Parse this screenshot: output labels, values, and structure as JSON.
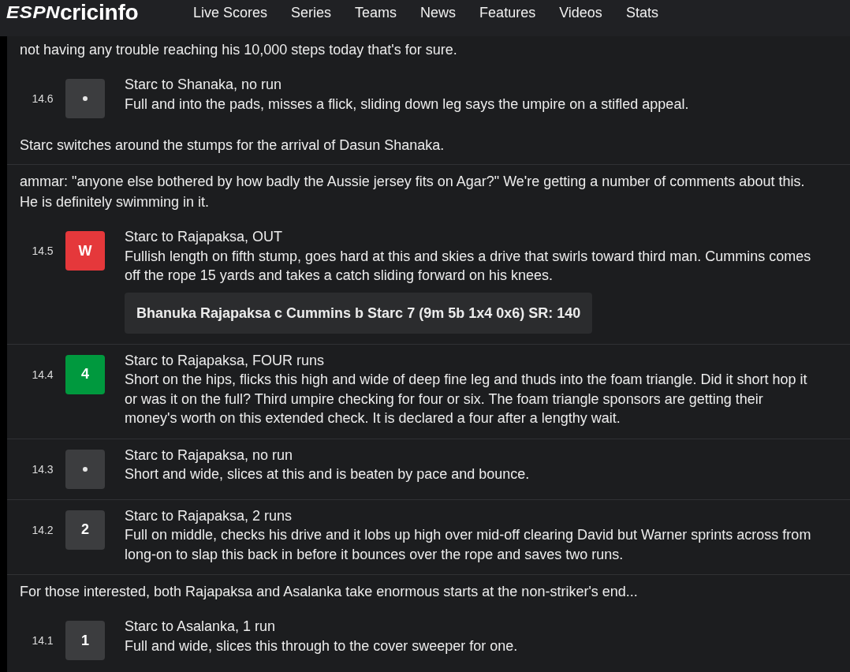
{
  "header": {
    "logo": {
      "mark": "ESPN",
      "wordmark": "cricinfo"
    },
    "nav": [
      "Live Scores",
      "Series",
      "Teams",
      "News",
      "Features",
      "Videos",
      "Stats"
    ]
  },
  "commentary": [
    {
      "items": [
        {
          "kind": "comment",
          "text": "not having any trouble reaching his 10,000 steps today that's for sure."
        },
        {
          "kind": "ball",
          "over": "14.6",
          "result": {
            "kind": "dot"
          },
          "title": "Starc to Shanaka, no run",
          "text": "Full and into the pads, misses a flick, sliding down leg says the umpire on a stifled appeal."
        },
        {
          "kind": "comment",
          "text": "Starc switches around the stumps for the arrival of Dasun Shanaka."
        }
      ]
    },
    {
      "items": [
        {
          "kind": "comment",
          "text": "ammar: \"anyone else bothered by how badly the Aussie jersey fits on Agar?\" We're getting a number of comments about this. He is definitely swimming in it."
        },
        {
          "kind": "ball",
          "over": "14.5",
          "result": {
            "kind": "wicket",
            "label": "W"
          },
          "title": "Starc to Rajapaksa, OUT",
          "text": "Fullish length on fifth stump, goes hard at this and skies a drive that swirls toward third man. Cummins comes off the rope 15 yards and takes a catch sliding forward on his knees.",
          "dismissal": "Bhanuka Rajapaksa c Cummins b Starc 7 (9m 5b 1x4 0x6) SR: 140"
        }
      ]
    },
    {
      "items": [
        {
          "kind": "ball",
          "over": "14.4",
          "result": {
            "kind": "boundary",
            "label": "4"
          },
          "title": "Starc to Rajapaksa, FOUR runs",
          "text": "Short on the hips, flicks this high and wide of deep fine leg and thuds into the foam triangle. Did it short hop it or was it on the full? Third umpire checking for four or six. The foam triangle sponsors are getting their money's worth on this extended check. It is declared a four after a lengthy wait."
        }
      ]
    },
    {
      "items": [
        {
          "kind": "ball",
          "over": "14.3",
          "result": {
            "kind": "dot"
          },
          "title": "Starc to Rajapaksa, no run",
          "text": "Short and wide, slices at this and is beaten by pace and bounce."
        }
      ]
    },
    {
      "items": [
        {
          "kind": "ball",
          "over": "14.2",
          "result": {
            "kind": "runs",
            "label": "2"
          },
          "title": "Starc to Rajapaksa, 2 runs",
          "text": "Full on middle, checks his drive and it lobs up high over mid-off clearing David but Warner sprints across from long-on to slap this back in before it bounces over the rope and saves two runs."
        }
      ]
    },
    {
      "items": [
        {
          "kind": "comment",
          "text": "For those interested, both Rajapaksa and Asalanka take enormous starts at the non-striker's end..."
        },
        {
          "kind": "ball",
          "over": "14.1",
          "result": {
            "kind": "runs",
            "label": "1"
          },
          "title": "Starc to Asalanka, 1 run",
          "text": "Full and wide, slices this through to the cover sweeper for one."
        }
      ]
    }
  ]
}
